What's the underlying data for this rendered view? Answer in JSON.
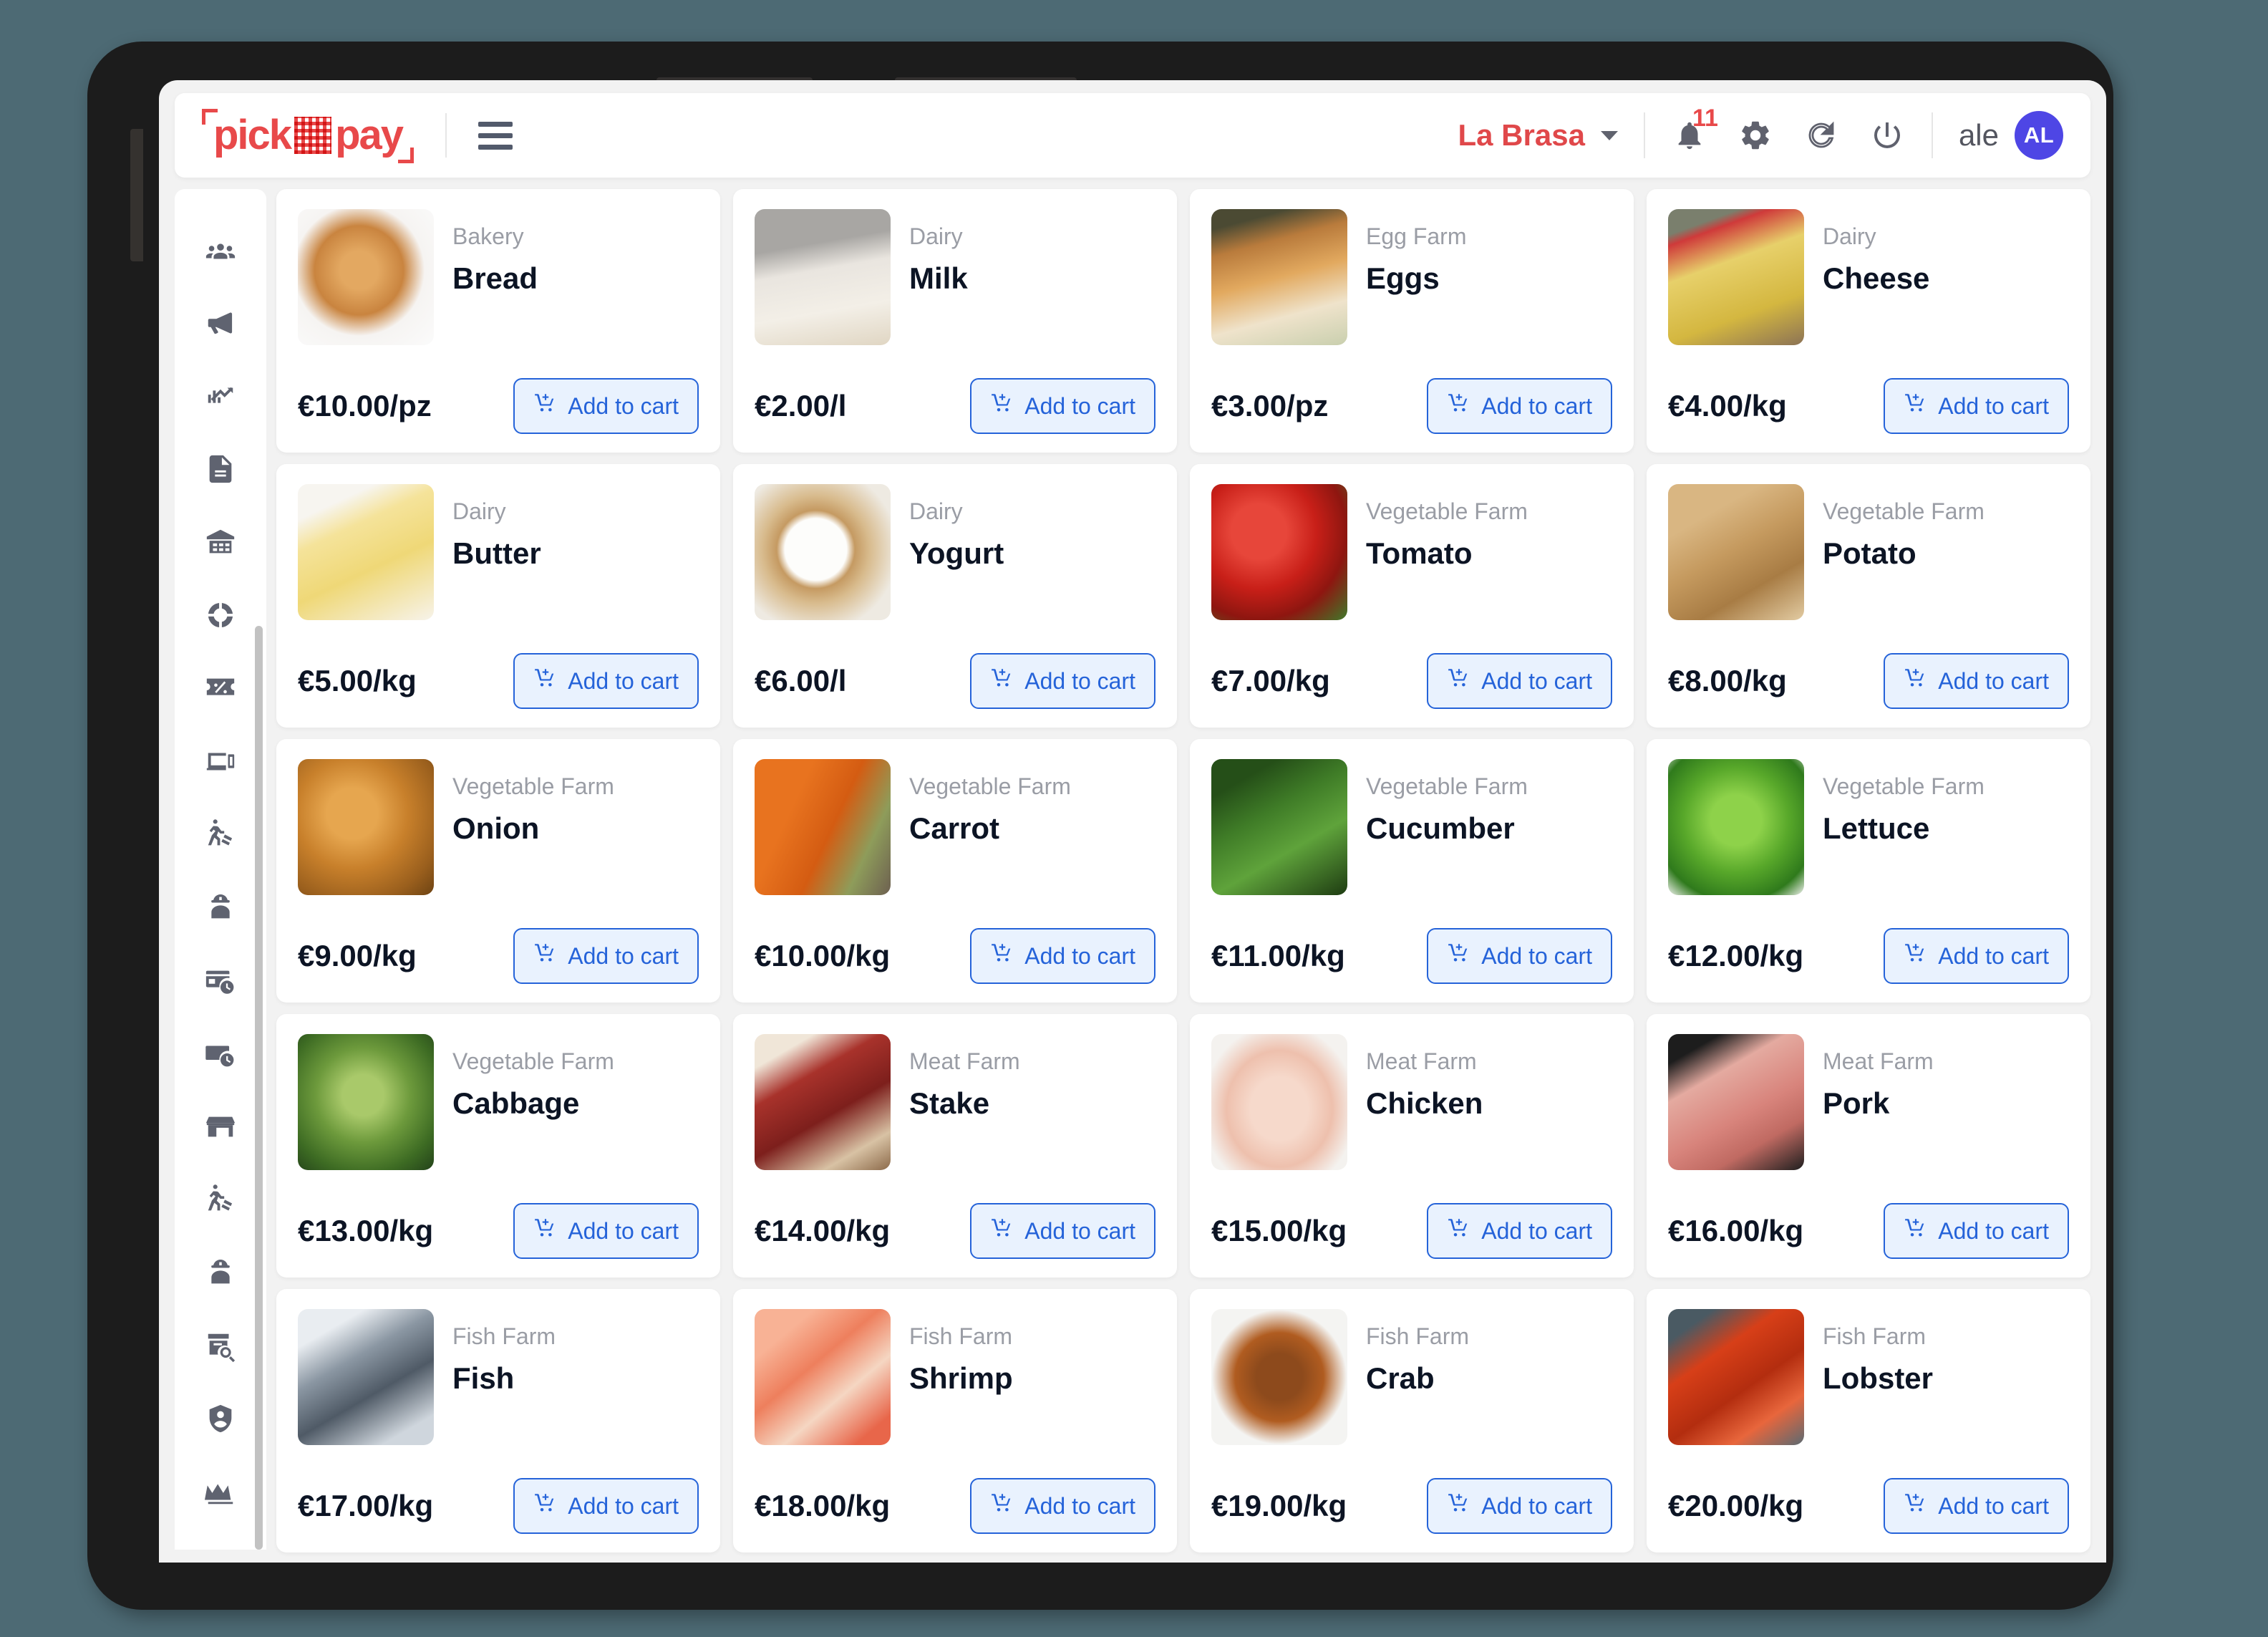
{
  "header": {
    "logo_text_left": "pick",
    "logo_text_right": "pay",
    "menu_icon": "hamburger-icon",
    "org_name": "La Brasa",
    "org_caret_icon": "chevron-down-icon",
    "notification_count": "11",
    "notification_icon": "bell-icon",
    "settings_icon": "gear-icon",
    "refresh_icon": "refresh-icon",
    "power_icon": "power-icon",
    "user_name": "ale",
    "avatar_initials": "AL"
  },
  "sidebar": {
    "items": [
      {
        "icon": "people-group-icon"
      },
      {
        "icon": "megaphone-icon"
      },
      {
        "icon": "analytics-chart-icon"
      },
      {
        "icon": "document-icon"
      },
      {
        "icon": "warehouse-icon"
      },
      {
        "icon": "donut-chart-icon"
      },
      {
        "icon": "discount-ticket-icon"
      },
      {
        "icon": "devices-icon"
      },
      {
        "icon": "delivery-worker-icon"
      },
      {
        "icon": "worker-helmet-icon"
      },
      {
        "icon": "card-clock-icon"
      },
      {
        "icon": "cash-clock-icon"
      },
      {
        "icon": "storefront-icon"
      },
      {
        "icon": "delivery-worker-icon"
      },
      {
        "icon": "worker-helmet-icon"
      },
      {
        "icon": "archive-search-icon"
      },
      {
        "icon": "shield-user-icon"
      },
      {
        "icon": "crown-icon"
      }
    ]
  },
  "catalog": {
    "add_to_cart_label": "Add to cart",
    "cart_icon": "add-to-cart-icon",
    "products": [
      {
        "supplier": "Bakery",
        "name": "Bread",
        "price": "€10.00/pz",
        "img": "bread"
      },
      {
        "supplier": "Dairy",
        "name": "Milk",
        "price": "€2.00/l",
        "img": "milk"
      },
      {
        "supplier": "Egg Farm",
        "name": "Eggs",
        "price": "€3.00/pz",
        "img": "eggs"
      },
      {
        "supplier": "Dairy",
        "name": "Cheese",
        "price": "€4.00/kg",
        "img": "cheese"
      },
      {
        "supplier": "Dairy",
        "name": "Butter",
        "price": "€5.00/kg",
        "img": "butter"
      },
      {
        "supplier": "Dairy",
        "name": "Yogurt",
        "price": "€6.00/l",
        "img": "yogurt"
      },
      {
        "supplier": "Vegetable Farm",
        "name": "Tomato",
        "price": "€7.00/kg",
        "img": "tomato"
      },
      {
        "supplier": "Vegetable Farm",
        "name": "Potato",
        "price": "€8.00/kg",
        "img": "potato"
      },
      {
        "supplier": "Vegetable Farm",
        "name": "Onion",
        "price": "€9.00/kg",
        "img": "onion"
      },
      {
        "supplier": "Vegetable Farm",
        "name": "Carrot",
        "price": "€10.00/kg",
        "img": "carrot"
      },
      {
        "supplier": "Vegetable Farm",
        "name": "Cucumber",
        "price": "€11.00/kg",
        "img": "cucumber"
      },
      {
        "supplier": "Vegetable Farm",
        "name": "Lettuce",
        "price": "€12.00/kg",
        "img": "lettuce"
      },
      {
        "supplier": "Vegetable Farm",
        "name": "Cabbage",
        "price": "€13.00/kg",
        "img": "cabbage"
      },
      {
        "supplier": "Meat Farm",
        "name": "Stake",
        "price": "€14.00/kg",
        "img": "stake"
      },
      {
        "supplier": "Meat Farm",
        "name": "Chicken",
        "price": "€15.00/kg",
        "img": "chicken"
      },
      {
        "supplier": "Meat Farm",
        "name": "Pork",
        "price": "€16.00/kg",
        "img": "pork"
      },
      {
        "supplier": "Fish Farm",
        "name": "Fish",
        "price": "€17.00/kg",
        "img": "fish"
      },
      {
        "supplier": "Fish Farm",
        "name": "Shrimp",
        "price": "€18.00/kg",
        "img": "shrimp"
      },
      {
        "supplier": "Fish Farm",
        "name": "Crab",
        "price": "€19.00/kg",
        "img": "crab"
      },
      {
        "supplier": "Fish Farm",
        "name": "Lobster",
        "price": "€20.00/kg",
        "img": "lobster"
      }
    ]
  },
  "colors": {
    "brand_red": "#e8494a",
    "accent_blue": "#2563d9",
    "avatar_purple": "#4e46e5",
    "page_background": "#4d6a74"
  }
}
